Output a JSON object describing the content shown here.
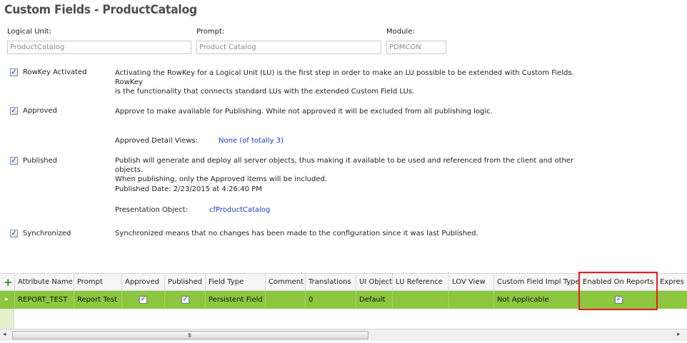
{
  "page": {
    "title": "Custom Fields - ProductCatalog"
  },
  "header_fields": {
    "logical_unit": {
      "label": "Logical Unit:",
      "value": "ProductCatalog"
    },
    "prompt": {
      "label": "Prompt:",
      "value": "Product Catalog"
    },
    "module": {
      "label": "Module:",
      "value": "PDMCON"
    }
  },
  "options": {
    "rowkey": {
      "label": "RowKey Activated",
      "checked": true,
      "desc1": "Activating the RowKey for a Logical Unit (LU) is the first step in order to make an LU possible to be extended with Custom Fields. RowKey",
      "desc2": "is the functionality that connects standard LUs with the extended Custom Field LUs."
    },
    "approved": {
      "label": "Approved",
      "checked": true,
      "desc": "Approve to make available for Publishing. While not approved it will be excluded from all publishing logic.",
      "detail_label": "Approved Detail Views:",
      "detail_value": "None (of totally 3)"
    },
    "published": {
      "label": "Published",
      "checked": true,
      "desc1": "Publish will generate and deploy all server objects, thus making it available to be used and referenced from the client and other objects.",
      "desc2": "When publishing, only the Approved items will be included.",
      "date_text": "Published Date: 2/23/2015 at 4:26:40 PM",
      "presentation_label": "Presentation Object:",
      "presentation_value": "cfProductCatalog"
    },
    "synchronized": {
      "label": "Synchronized",
      "checked": true,
      "desc": "Synchronized means that no changes has been made to the configuration since it was last Published."
    }
  },
  "grid": {
    "add_icon": "plus-icon",
    "columns": [
      "Attribute Name",
      "Prompt",
      "Approved",
      "Published",
      "Field Type",
      "Comment",
      "Translations",
      "UI Object",
      "LU Reference",
      "LOV View",
      "Custom Field Impl Type",
      "Enabled On Reports",
      "Expres"
    ],
    "row": {
      "attribute_name": "REPORT_TEST",
      "prompt": "Report Test",
      "approved": true,
      "published": true,
      "field_type": "Persistent Field",
      "comment": "",
      "translations": "0",
      "ui_object": "Default",
      "lu_reference": "",
      "lov_view": "",
      "impl_type": "Not Applicable",
      "enabled_on_reports": true
    },
    "check_mark": "✓",
    "row_marker": "▸",
    "scroll_left": "◂",
    "scroll_right": "▸",
    "scroll_grip": "III"
  }
}
